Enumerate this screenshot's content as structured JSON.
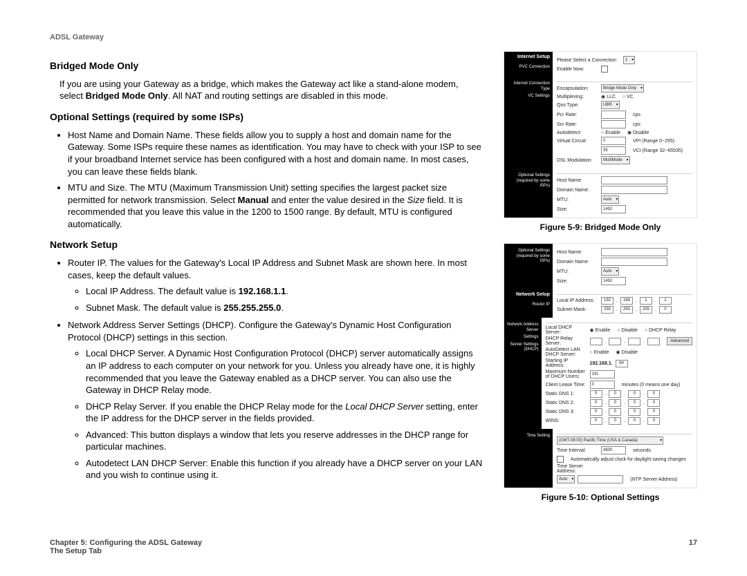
{
  "header": "ADSL Gateway",
  "h_bridged": "Bridged Mode Only",
  "p_bridged_1": "If you are using your Gateway as a bridge, which makes the Gateway act like a stand-alone modem, select ",
  "p_bridged_bold": "Bridged Mode Only",
  "p_bridged_2": ". All NAT and routing settings are disabled in this mode.",
  "h_opt": "Optional Settings (required by some ISPs)",
  "li_host": "Host Name and Domain Name. These fields allow you to supply a host and domain name for the Gateway. Some ISPs require these names as identification. You may have to check with your ISP to see if your broadband Internet service has been configured with a host and domain name. In most cases, you can leave these fields blank.",
  "li_mtu_1": "MTU and Size. The MTU (Maximum Transmission Unit) setting specifies the largest packet size permitted for network transmission. Select ",
  "li_mtu_b": "Manual",
  "li_mtu_2": " and enter the value desired in the ",
  "li_mtu_i": "Size",
  "li_mtu_3": " field. It is recommended that you leave this value in the 1200 to 1500 range. By default, MTU is configured automatically.",
  "h_net": "Network Setup",
  "li_router": "Router IP. The values for the Gateway's Local IP Address and Subnet Mask are shown here. In most cases, keep the default values.",
  "li_localip_1": "Local IP Address. The default value is ",
  "li_localip_b": "192.168.1.1",
  "li_localip_2": ".",
  "li_subnet_1": "Subnet Mask. The default value is ",
  "li_subnet_b": "255.255.255.0",
  "li_subnet_2": ".",
  "li_dhcp_intro": "Network Address Server Settings (DHCP). Configure the Gateway's Dynamic Host Configuration Protocol (DHCP) settings in this section.",
  "li_dhcp_local": "Local DHCP Server. A Dynamic Host Configuration Protocol (DHCP) server automatically assigns an IP address to each computer on your network for you. Unless you already have one, it is highly recommended that you leave the Gateway enabled as a DHCP server. You can also use the Gateway in DHCP Relay mode.",
  "li_dhcp_relay_1": "DHCP Relay Server. If you enable the DHCP Relay mode for the ",
  "li_dhcp_relay_i": "Local DHCP Server",
  "li_dhcp_relay_2": " setting, enter the IP address for the DHCP server in the fields provided.",
  "li_adv": "Advanced: This button displays a window that lets you reserve addresses in the DHCP range for particular machines.",
  "li_autodetect": "Autodetect LAN DHCP Server: Enable this function if you already have a DHCP server on your LAN and you wish to continue using it.",
  "footer_l1": "Chapter 5: Configuring the ADSL Gateway",
  "footer_l2": "The Setup Tab",
  "page_num": "17",
  "cap1": "Figure 5-9: Bridged Mode Only",
  "cap2": "Figure 5-10: Optional Settings",
  "f1": {
    "side_sec": "Internet Setup",
    "side_c1": "PVC Connection",
    "side_c2": "Internet Connection Type",
    "side_c3": "VC Settings",
    "side_opt": "Optional Settings\n(required by some ISPs)",
    "lbl_please": "Please Select a Connection",
    "lbl_enable": "Enable Now:",
    "lbl_encap": "Encapsulation:",
    "val_encap": "Bridge Mode Only",
    "lbl_mux": "Multiplexing:",
    "r_llc": "LLC",
    "r_vc": "VC",
    "lbl_qos": "Qos Type:",
    "val_qos": "UBR",
    "lbl_pcr": "Pcr Rate:",
    "unit_cps": "cps",
    "lbl_scr": "Scr Rate:",
    "lbl_autod": "Autodetect:",
    "r_en": "Enable",
    "r_dis": "Disable",
    "lbl_vc": "Virtual Circuit:",
    "vpi": "0",
    "vpi_r": "VPI (Range 0~255)",
    "vci": "35",
    "vci_r": "VCI (Range 32~65535)",
    "lbl_dslmod": "DSL Modulation:",
    "val_dslmod": "MultiMode",
    "lbl_host": "Host Name:",
    "lbl_domain": "Domain Name:",
    "lbl_mtu": "MTU:",
    "val_mtu": "Auto",
    "lbl_size": "Size:",
    "val_size": "1492"
  },
  "f2": {
    "side_opt": "Optional Settings\n(required by some ISPs)",
    "side_net": "Network Setup",
    "side_r": "Router IP",
    "side_nas1": "Network Address Server",
    "side_nas2": "Settings",
    "side_nas3": "Server Settings (DHCP)",
    "side_time": "Time Setting",
    "lbl_host": "Host Name:",
    "lbl_domain": "Domain Name:",
    "lbl_mtu": "MTU:",
    "val_mtu": "Auto",
    "lbl_size": "Size:",
    "val_size": "1492",
    "lbl_localip": "Local IP Address:",
    "ip": [
      "192",
      "168",
      "1",
      "1"
    ],
    "lbl_subnet": "Subnet Mask:",
    "mask": [
      "255",
      "255",
      "255",
      "0"
    ],
    "lbl_ldhcp": "Local DHCP Server:",
    "r_en": "Enable",
    "r_dis": "Disable",
    "r_relay": "DHCP Relay",
    "lbl_relay": "DHCP Relay Server:",
    "btn_adv": "Advanced",
    "lbl_autod": "AutoDetect LAN DHCP Server:",
    "lbl_start": "Starting IP Address:",
    "start_prefix": "192.168.1.",
    "start_v": "64",
    "lbl_max": "Maximum Number of DHCP Users:",
    "max_v": "191",
    "lbl_lease": "Client Lease Time:",
    "lease_v": "0",
    "lease_u": "minutes (0 means one day)",
    "lbl_dns1": "Static DNS 1:",
    "lbl_dns2": "Static DNS 2:",
    "lbl_dns3": "Static DNS 3:",
    "lbl_wins": "WINS:",
    "z": [
      "0",
      "0",
      "0",
      "0"
    ],
    "tz": "(GMT-08:00) Pacific Time (USA & Canada)",
    "lbl_ti": "Time Interval:",
    "ti_v": "3600",
    "ti_u": "seconds",
    "chk_dst": "Automatically adjust clock for daylight saving changes",
    "lbl_tsa": "Time Server Address:",
    "tsa_v": "Auto",
    "ntp": "(NTP Server Address)"
  }
}
